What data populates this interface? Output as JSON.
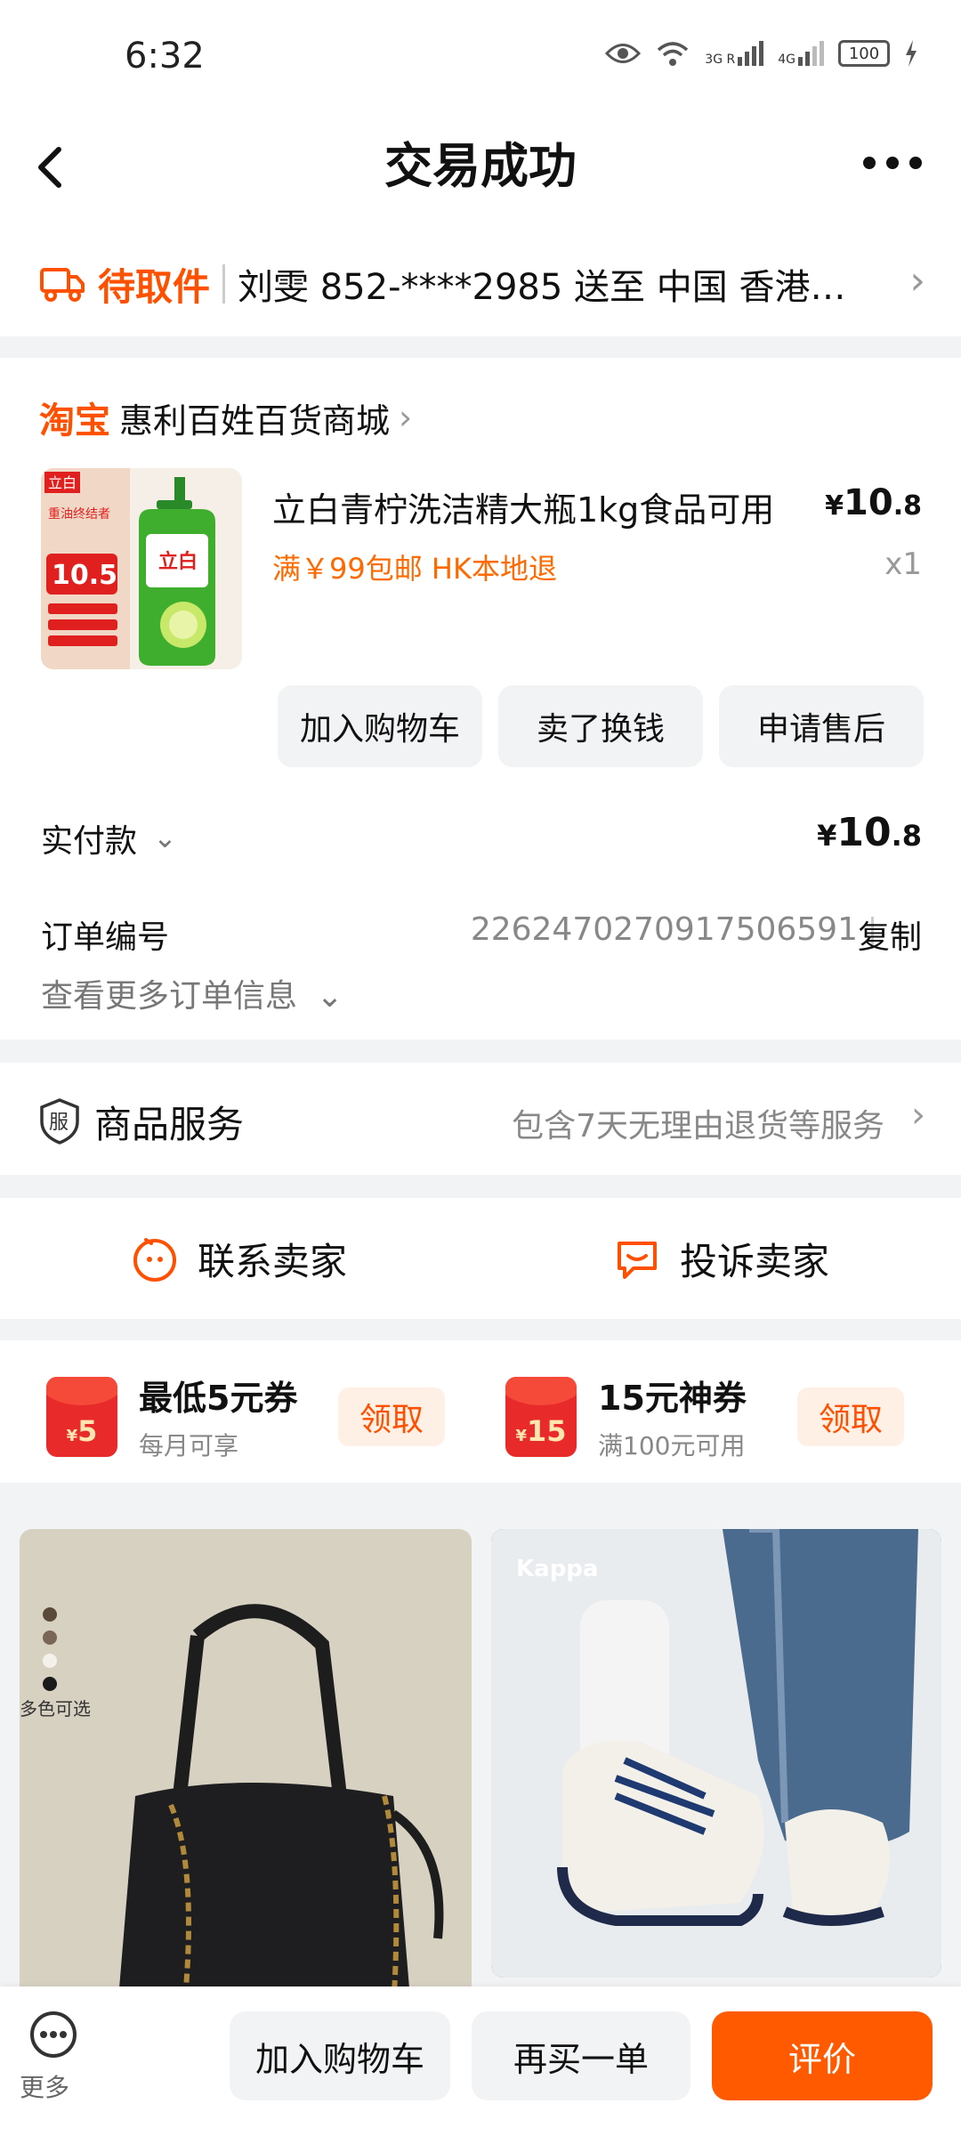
{
  "status_bar": {
    "time": "6:32",
    "network1": "3G R",
    "network2": "4G",
    "battery": "100"
  },
  "header": {
    "title": "交易成功"
  },
  "delivery": {
    "status": "待取件",
    "address": "刘雯 852-****2985 送至 中国 香港…"
  },
  "order": {
    "platform": "淘宝",
    "shop": "惠利百姓百货商城",
    "product_name": "立白青柠洗洁精大瓶1kg食品可用",
    "price_symbol": "¥",
    "price_int": "10",
    "price_dec": ".8",
    "tags": "满￥99包邮  HK本地退",
    "quantity": "x1",
    "thumb_texts": {
      "brand": "立白",
      "badge": "10.5",
      "slogan": "重油终结者"
    },
    "actions": [
      "加入购物车",
      "卖了换钱",
      "申请售后"
    ],
    "paid_label": "实付款",
    "paid_symbol": "¥",
    "paid_int": "10",
    "paid_dec": ".8",
    "order_no_label": "订单编号",
    "order_no": "2262470270917506591",
    "copy_label": "复制",
    "more_info": "查看更多订单信息"
  },
  "service": {
    "icon_text": "服",
    "title": "商品服务",
    "desc": "包含7天无理由退货等服务"
  },
  "contact": {
    "seller": "联系卖家",
    "complain": "投诉卖家"
  },
  "coupons": [
    {
      "amount": "5",
      "title": "最低5元券",
      "sub": "每月可享",
      "claim": "领取"
    },
    {
      "amount": "15",
      "title": "15元神券",
      "sub": "满100元可用",
      "claim": "领取"
    }
  ],
  "recommendations": [
    {
      "caption": "多色可选"
    },
    {
      "brand": "Kappa"
    }
  ],
  "bottom_bar": {
    "more": "更多",
    "add_cart": "加入购物车",
    "rebuy": "再买一单",
    "review": "评价"
  },
  "colors": {
    "accent": "#ff5000",
    "review_button": "#ff5a00",
    "background": "#f2f3f5"
  }
}
